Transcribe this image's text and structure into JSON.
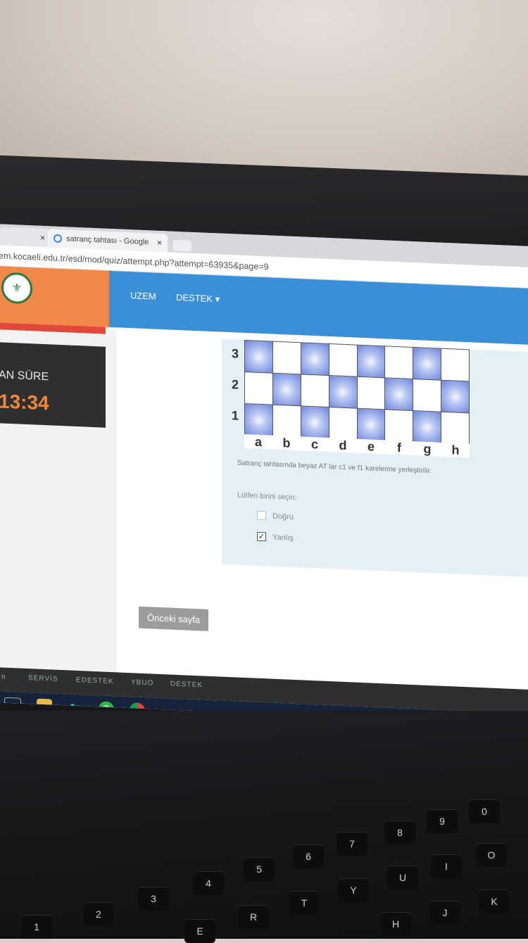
{
  "browser": {
    "tab1": {
      "label": "",
      "close": "×"
    },
    "tab2": {
      "label": "satranç tahtası - Google",
      "close": "×"
    },
    "url": "em.kocaeli.edu.tr/esd/mod/quiz/attempt.php?attempt=63935&page=9"
  },
  "header": {
    "nav": [
      "UZEM",
      "DESTEK ▾"
    ]
  },
  "timer": {
    "label": "AN SÜRE",
    "value": "13:34"
  },
  "question": {
    "board": {
      "ranks": [
        "3",
        "2",
        "1"
      ],
      "files": [
        "a",
        "b",
        "c",
        "d",
        "e",
        "f",
        "g",
        "h"
      ]
    },
    "text": "Satranç tahtasında beyaz AT lar c1 ve f1 karelerine yerleştirilir.",
    "prompt": "Lütfen birini seçin:",
    "options": [
      {
        "label": "Doğru",
        "checked": false
      },
      {
        "label": "Yanlış",
        "checked": true
      }
    ]
  },
  "navigation": {
    "prev_button": "Önceki sayfa"
  },
  "footer": {
    "links": [
      "n",
      "SERVİS",
      "EDESTEK",
      "YBUO",
      "DESTEK"
    ]
  },
  "keyboard": {
    "keys_row1": [
      "1",
      "2",
      "3",
      "4",
      "5",
      "6",
      "7",
      "8",
      "9",
      "0"
    ],
    "keys_row2": [
      "E",
      "R",
      "T",
      "Y",
      "U",
      "I",
      "O"
    ],
    "keys_row3": [
      "H",
      "J",
      "K"
    ]
  },
  "colors": {
    "accent_orange": "#f2874a",
    "nav_blue": "#3a8fd6",
    "timer_orange": "#f1873a"
  }
}
